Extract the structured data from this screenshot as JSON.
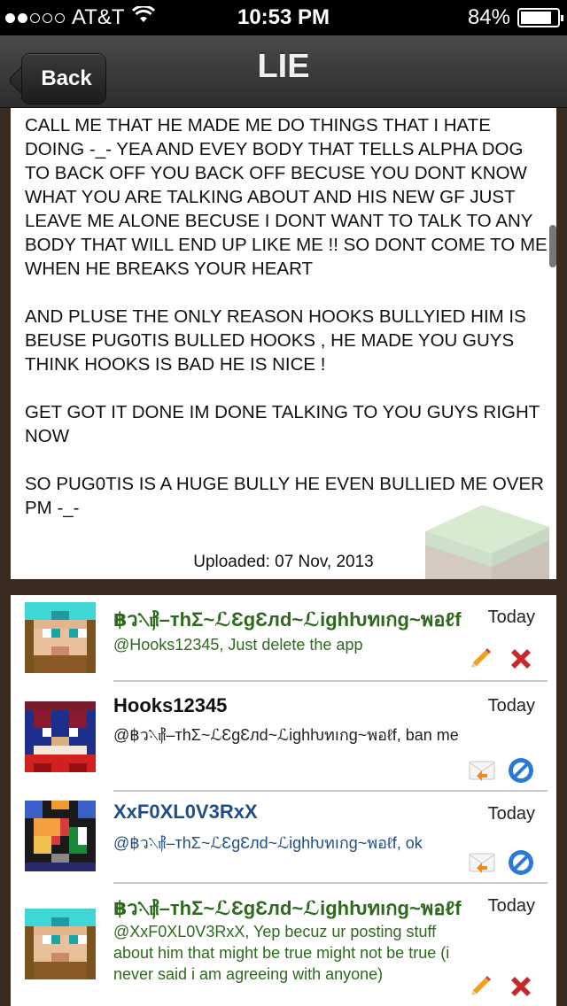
{
  "status_bar": {
    "carrier": "AT&T",
    "time": "10:53 PM",
    "battery_text": "84%",
    "battery_level": 0.84,
    "signal_bars_filled": 2,
    "signal_bars_total": 5
  },
  "nav": {
    "back_label": "Back",
    "title": "LIE"
  },
  "post": {
    "paragraphs": [
      "CALL ME THAT HE MADE ME DO THINGS THAT I HATE DOING -_- YEA AND EVEY BODY THAT TELLS ALPHA DOG TO BACK OFF YOU BACK OFF BECUSE YOU DONT KNOW WHAT YOU ARE TALKING ABOUT AND HIS NEW GF JUST LEAVE ME ALONE BECUSE I DONT WANT TO TALK TO ANY BODY THAT WILL END UP LIKE ME !! SO DONT COME TO ME WHEN HE BREAKS YOUR HEART",
      "AND PLUSE THE ONLY REASON HOOKS BULLYIED HIM IS BEUSE PUG0TIS BULLED HOOKS , HE MADE YOU GUYS THINK HOOKS IS BAD HE IS NICE !",
      "GET GOT IT DONE IM DONE TALKING TO YOU GUYS RIGHT NOW",
      "SO PUG0TIS IS A HUGE BULLY HE EVEN BULLIED ME OVER PM -_-"
    ],
    "uploaded": "Uploaded: 07 Nov, 2013"
  },
  "comments": [
    {
      "username": "฿ว⳻⳦–тhΣ~ℒƐgƐлd~ℒighƕทıกg~พอℓf",
      "date": "Today",
      "text": "@Hooks12345, Just delete the app",
      "name_color": "#2e6a1e",
      "text_color": "#2e6a1e",
      "actions": [
        "pencil-icon",
        "delete-x-icon"
      ]
    },
    {
      "username": "Hooks12345",
      "date": "Today",
      "text": "@฿ว⳻⳦–тhΣ~ℒƐgƐлd~ℒighƕทıกg~พอℓf, ban me",
      "name_color": "#111111",
      "text_color": "#222222",
      "actions": [
        "reply-mail-icon",
        "block-icon"
      ]
    },
    {
      "username": "XxF0XL0V3RxX",
      "date": "Today",
      "text": "@฿ว⳻⳦–тhΣ~ℒƐgƐлd~ℒighƕทıกg~พอℓf, ok",
      "name_color": "#1f4f8a",
      "text_color": "#1f4f8a",
      "actions": [
        "reply-mail-icon",
        "block-icon"
      ]
    },
    {
      "username": "฿ว⳻⳦–тhΣ~ℒƐgƐлd~ℒighƕทıกg~พอℓf",
      "date": "Today",
      "text": "@XxF0XL0V3RxX, Yep becuz ur posting stuff about him that might be true might not be true (i never said i am agreeing with anyone)",
      "name_color": "#2e6a1e",
      "text_color": "#2e6a1e",
      "actions": [
        "pencil-icon",
        "delete-x-icon"
      ]
    }
  ]
}
